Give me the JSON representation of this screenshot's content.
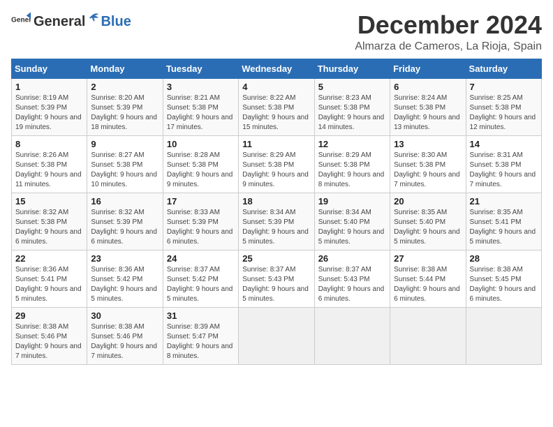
{
  "header": {
    "logo_general": "General",
    "logo_blue": "Blue",
    "month_title": "December 2024",
    "location": "Almarza de Cameros, La Rioja, Spain"
  },
  "days_of_week": [
    "Sunday",
    "Monday",
    "Tuesday",
    "Wednesday",
    "Thursday",
    "Friday",
    "Saturday"
  ],
  "weeks": [
    [
      {
        "day": "1",
        "sunrise": "8:19 AM",
        "sunset": "5:39 PM",
        "daylight": "9 hours and 19 minutes."
      },
      {
        "day": "2",
        "sunrise": "8:20 AM",
        "sunset": "5:39 PM",
        "daylight": "9 hours and 18 minutes."
      },
      {
        "day": "3",
        "sunrise": "8:21 AM",
        "sunset": "5:38 PM",
        "daylight": "9 hours and 17 minutes."
      },
      {
        "day": "4",
        "sunrise": "8:22 AM",
        "sunset": "5:38 PM",
        "daylight": "9 hours and 15 minutes."
      },
      {
        "day": "5",
        "sunrise": "8:23 AM",
        "sunset": "5:38 PM",
        "daylight": "9 hours and 14 minutes."
      },
      {
        "day": "6",
        "sunrise": "8:24 AM",
        "sunset": "5:38 PM",
        "daylight": "9 hours and 13 minutes."
      },
      {
        "day": "7",
        "sunrise": "8:25 AM",
        "sunset": "5:38 PM",
        "daylight": "9 hours and 12 minutes."
      }
    ],
    [
      {
        "day": "8",
        "sunrise": "8:26 AM",
        "sunset": "5:38 PM",
        "daylight": "9 hours and 11 minutes."
      },
      {
        "day": "9",
        "sunrise": "8:27 AM",
        "sunset": "5:38 PM",
        "daylight": "9 hours and 10 minutes."
      },
      {
        "day": "10",
        "sunrise": "8:28 AM",
        "sunset": "5:38 PM",
        "daylight": "9 hours and 9 minutes."
      },
      {
        "day": "11",
        "sunrise": "8:29 AM",
        "sunset": "5:38 PM",
        "daylight": "9 hours and 9 minutes."
      },
      {
        "day": "12",
        "sunrise": "8:29 AM",
        "sunset": "5:38 PM",
        "daylight": "9 hours and 8 minutes."
      },
      {
        "day": "13",
        "sunrise": "8:30 AM",
        "sunset": "5:38 PM",
        "daylight": "9 hours and 7 minutes."
      },
      {
        "day": "14",
        "sunrise": "8:31 AM",
        "sunset": "5:38 PM",
        "daylight": "9 hours and 7 minutes."
      }
    ],
    [
      {
        "day": "15",
        "sunrise": "8:32 AM",
        "sunset": "5:38 PM",
        "daylight": "9 hours and 6 minutes."
      },
      {
        "day": "16",
        "sunrise": "8:32 AM",
        "sunset": "5:39 PM",
        "daylight": "9 hours and 6 minutes."
      },
      {
        "day": "17",
        "sunrise": "8:33 AM",
        "sunset": "5:39 PM",
        "daylight": "9 hours and 6 minutes."
      },
      {
        "day": "18",
        "sunrise": "8:34 AM",
        "sunset": "5:39 PM",
        "daylight": "9 hours and 5 minutes."
      },
      {
        "day": "19",
        "sunrise": "8:34 AM",
        "sunset": "5:40 PM",
        "daylight": "9 hours and 5 minutes."
      },
      {
        "day": "20",
        "sunrise": "8:35 AM",
        "sunset": "5:40 PM",
        "daylight": "9 hours and 5 minutes."
      },
      {
        "day": "21",
        "sunrise": "8:35 AM",
        "sunset": "5:41 PM",
        "daylight": "9 hours and 5 minutes."
      }
    ],
    [
      {
        "day": "22",
        "sunrise": "8:36 AM",
        "sunset": "5:41 PM",
        "daylight": "9 hours and 5 minutes."
      },
      {
        "day": "23",
        "sunrise": "8:36 AM",
        "sunset": "5:42 PM",
        "daylight": "9 hours and 5 minutes."
      },
      {
        "day": "24",
        "sunrise": "8:37 AM",
        "sunset": "5:42 PM",
        "daylight": "9 hours and 5 minutes."
      },
      {
        "day": "25",
        "sunrise": "8:37 AM",
        "sunset": "5:43 PM",
        "daylight": "9 hours and 5 minutes."
      },
      {
        "day": "26",
        "sunrise": "8:37 AM",
        "sunset": "5:43 PM",
        "daylight": "9 hours and 6 minutes."
      },
      {
        "day": "27",
        "sunrise": "8:38 AM",
        "sunset": "5:44 PM",
        "daylight": "9 hours and 6 minutes."
      },
      {
        "day": "28",
        "sunrise": "8:38 AM",
        "sunset": "5:45 PM",
        "daylight": "9 hours and 6 minutes."
      }
    ],
    [
      {
        "day": "29",
        "sunrise": "8:38 AM",
        "sunset": "5:46 PM",
        "daylight": "9 hours and 7 minutes."
      },
      {
        "day": "30",
        "sunrise": "8:38 AM",
        "sunset": "5:46 PM",
        "daylight": "9 hours and 7 minutes."
      },
      {
        "day": "31",
        "sunrise": "8:39 AM",
        "sunset": "5:47 PM",
        "daylight": "9 hours and 8 minutes."
      },
      null,
      null,
      null,
      null
    ]
  ],
  "labels": {
    "sunrise_prefix": "Sunrise: ",
    "sunset_prefix": "Sunset: ",
    "daylight_prefix": "Daylight: "
  }
}
